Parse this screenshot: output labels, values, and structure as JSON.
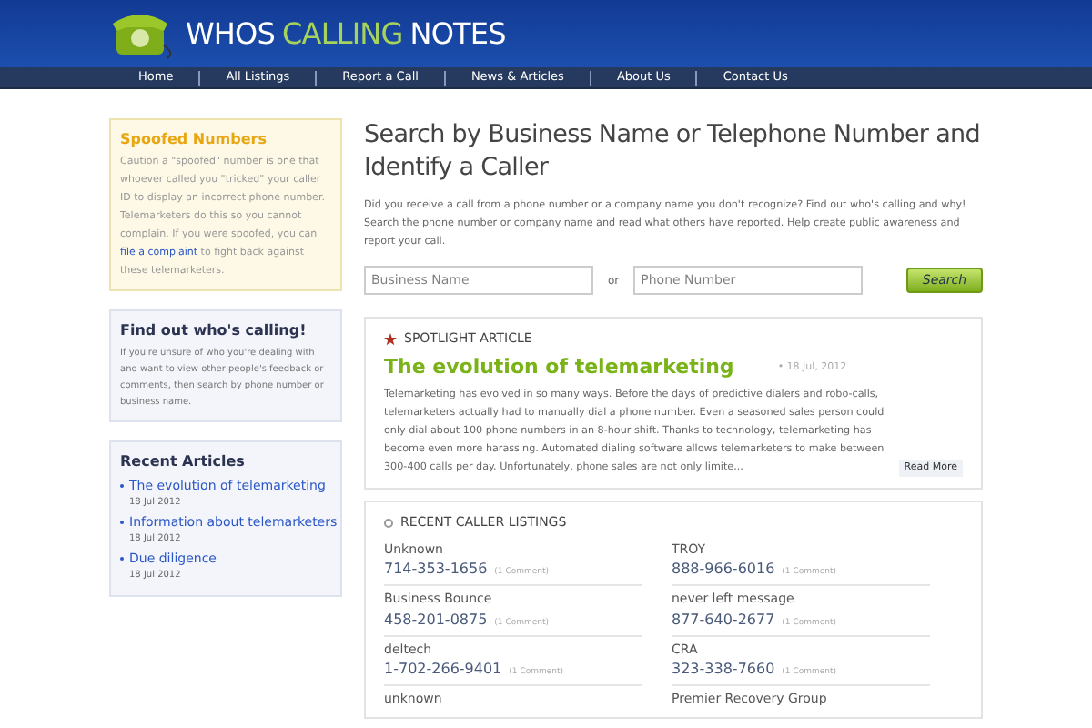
{
  "logo": {
    "word_1": "WHOS",
    "word_2": "CALLING",
    "word_3": "NOTES"
  },
  "nav": [
    "Home",
    "All Listings",
    "Report a Call",
    "News & Articles",
    "About Us",
    "Contact Us"
  ],
  "spoofed": {
    "title": "Spoofed Numbers",
    "text_before": "Caution a \"spoofed\" number is one that whoever called you \"tricked\" your caller ID to display an incorrect phone number. Telemarketers do this so you cannot complain. If you were spoofed, you can",
    "link": "file a complaint",
    "text_after": "to fight back against these telemarketers."
  },
  "find_out": {
    "title": "Find out who's calling!",
    "text": "If you're unsure of who you're dealing with and want to view other people's feedback or comments, then search by phone number or business name."
  },
  "recent_articles": {
    "title": "Recent Articles",
    "items": [
      {
        "title": "The evolution of telemarketing",
        "date": "18 Jul 2012"
      },
      {
        "title": "Information about telemarketers",
        "date": "18 Jul 2012"
      },
      {
        "title": "Due diligence",
        "date": "18 Jul 2012"
      }
    ]
  },
  "search": {
    "heading": "Search by Business Name or Telephone Number and Identify a Caller",
    "intro": "Did you receive a call from a phone number or a company name you don't recognize? Find out who's calling and why! Search the phone number or company name and read what others have reported. Help create public awareness and report your call.",
    "business_placeholder": "Business Name",
    "or": "or",
    "phone_placeholder": "Phone Number",
    "button": "Search"
  },
  "spotlight": {
    "label": "SPOTLIGHT ARTICLE",
    "title": "The evolution of telemarketing",
    "date": "• 18 Jul, 2012",
    "excerpt": "Telemarketing has evolved in so many ways. Before the days of predictive dialers and robo-calls, telemarketers actually had to manually dial a phone number. Even a seasoned sales person could only dial about 100 phone numbers in an 8-hour shift. Thanks to technology, telemarketing has become even more harassing. Automated dialing software allows telemarketers to make between 300-400 calls per day. Unfortunately, phone sales are not only limite...",
    "read_more": "Read More"
  },
  "listings": {
    "title": "RECENT CALLER LISTINGS",
    "items": [
      {
        "name": "Unknown",
        "phone": "714-353-1656",
        "comments": "(1 Comment)"
      },
      {
        "name": "TROY",
        "phone": "888-966-6016",
        "comments": "(1 Comment)"
      },
      {
        "name": "Business Bounce",
        "phone": "458-201-0875",
        "comments": "(1 Comment)"
      },
      {
        "name": "never left message",
        "phone": "877-640-2677",
        "comments": "(1 Comment)"
      },
      {
        "name": "deltech",
        "phone": "1-702-266-9401",
        "comments": "(1 Comment)"
      },
      {
        "name": "CRA",
        "phone": "323-338-7660",
        "comments": "(1 Comment)"
      },
      {
        "name": "unknown"
      },
      {
        "name": "Premier Recovery Group"
      }
    ]
  }
}
